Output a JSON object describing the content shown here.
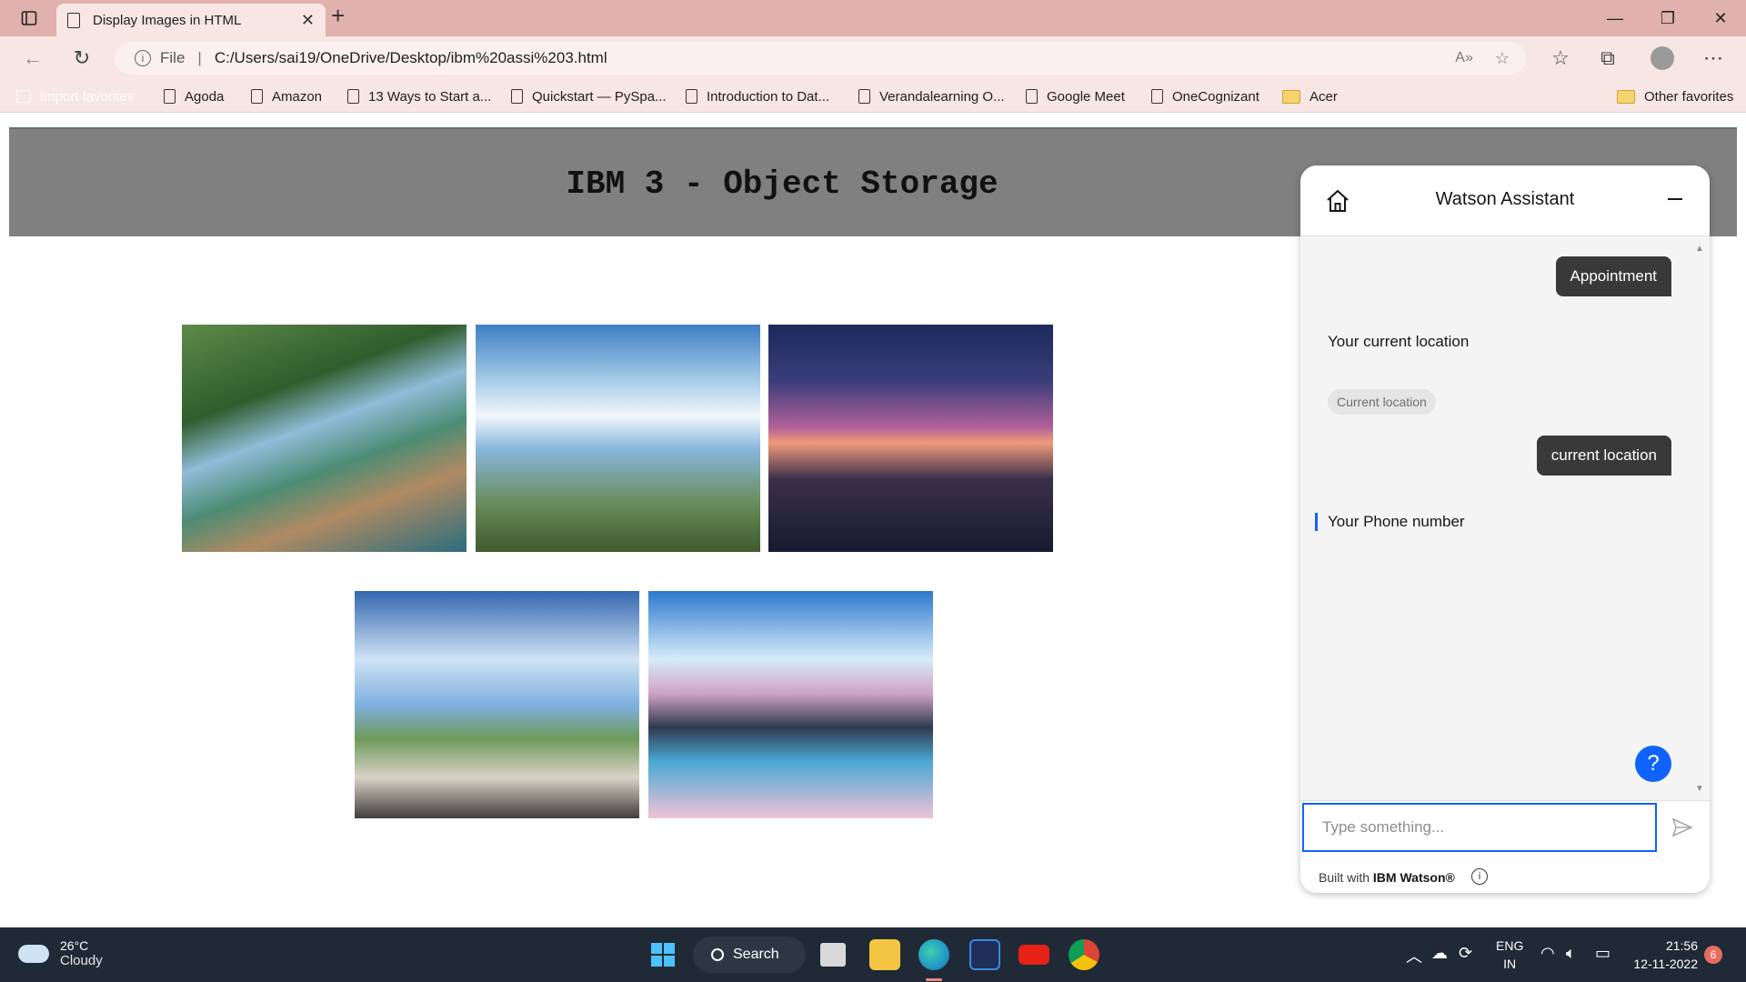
{
  "browser": {
    "tab_title": "Display Images in HTML",
    "url_scheme_label": "File",
    "url": "C:/Users/sai19/OneDrive/Desktop/ibm%20assi%203.html"
  },
  "bookmarks": [
    {
      "label": "Import favorites",
      "icon": "import-icon"
    },
    {
      "label": "Agoda",
      "icon": "doc-icon"
    },
    {
      "label": "Amazon",
      "icon": "doc-icon"
    },
    {
      "label": "13 Ways to Start a...",
      "icon": "doc-icon"
    },
    {
      "label": "Quickstart — PySpa...",
      "icon": "doc-icon"
    },
    {
      "label": "Introduction to Dat...",
      "icon": "doc-icon"
    },
    {
      "label": "Verandalearning O...",
      "icon": "doc-icon"
    },
    {
      "label": "Google Meet",
      "icon": "doc-icon"
    },
    {
      "label": "OneCognizant",
      "icon": "doc-icon"
    },
    {
      "label": "Acer",
      "icon": "folder-icon"
    },
    {
      "label": "Other favorites",
      "icon": "folder-icon"
    }
  ],
  "page": {
    "title": "IBM 3 - Object Storage",
    "images_count": 5
  },
  "chat": {
    "title": "Watson Assistant",
    "messages": [
      {
        "from": "user",
        "text": "Appointment"
      },
      {
        "from": "bot",
        "text": "Your current location"
      },
      {
        "from": "bot-chip",
        "text": "Current location"
      },
      {
        "from": "user",
        "text": "current location"
      },
      {
        "from": "bot",
        "text": "Your Phone number"
      }
    ],
    "input_placeholder": "Type something...",
    "built_with_prefix": "Built with ",
    "built_with_brand": "IBM Watson®",
    "help_label": "?"
  },
  "taskbar": {
    "weather_temp": "26°C",
    "weather_condition": "Cloudy",
    "search_label": "Search",
    "lang_top": "ENG",
    "lang_bottom": "IN",
    "time": "21:56",
    "date": "12-11-2022",
    "notification_count": "6"
  },
  "colors": {
    "titlebar": "#e0b1ad",
    "page_header": "#808080",
    "watson_blue": "#0f62fe",
    "user_bubble": "#393939",
    "taskbar": "#202a36"
  }
}
